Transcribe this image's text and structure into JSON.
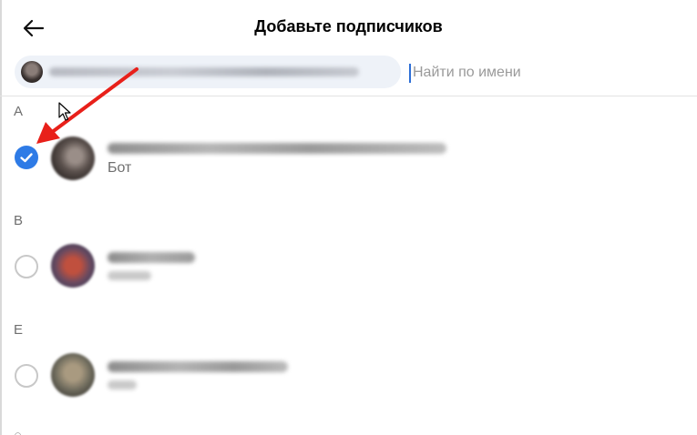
{
  "header": {
    "back_icon": "arrow-left-icon",
    "title": "Добавьте подписчиков"
  },
  "search": {
    "placeholder": "Найти по имени",
    "value": ""
  },
  "sections": [
    {
      "letter": "А",
      "contacts": [
        {
          "subtitle": "Бот",
          "selected": true
        }
      ]
    },
    {
      "letter": "В",
      "contacts": [
        {
          "subtitle": "",
          "selected": false
        }
      ]
    },
    {
      "letter": "Е",
      "contacts": [
        {
          "subtitle": "",
          "selected": false
        }
      ]
    }
  ],
  "colors": {
    "accent": "#2e7be6",
    "annotation_arrow": "#e8201a",
    "chip_bg": "#eef2f8"
  },
  "icons": {
    "check": "check-icon",
    "cursor": "mouse-pointer-icon"
  }
}
